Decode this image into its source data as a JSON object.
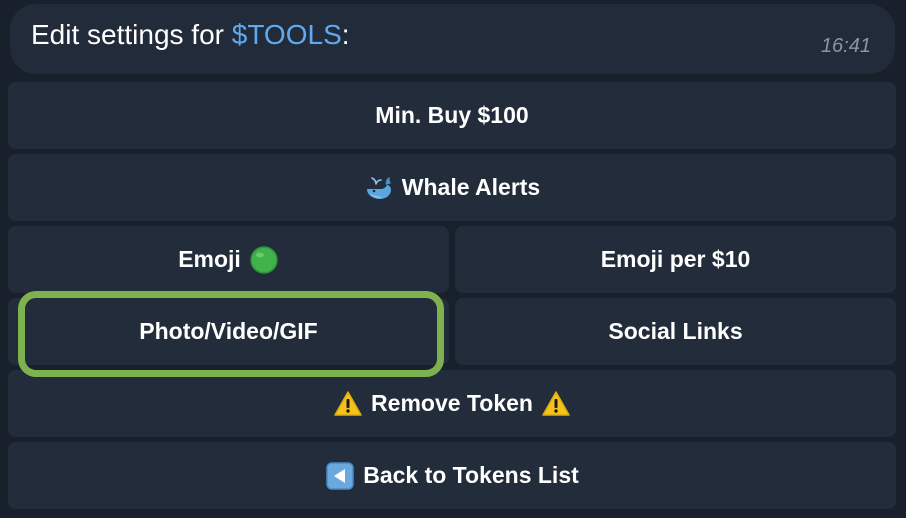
{
  "message": {
    "text_prefix": "Edit settings for ",
    "ticker": "$TOOLS",
    "text_suffix": ":",
    "time": "16:41"
  },
  "buttons": {
    "min_buy": "Min. Buy $100",
    "whale_alerts": "Whale Alerts",
    "emoji": "Emoji",
    "emoji_per": "Emoji per $10",
    "media": "Photo/Video/GIF",
    "social_links": "Social Links",
    "remove_token": "Remove Token",
    "back": "Back to Tokens List"
  },
  "icons": {
    "whale": "whale-icon",
    "emoji": "green-circle-icon",
    "warning": "warning-icon",
    "back": "back-arrow-icon"
  },
  "colors": {
    "ticker": "#5ea9f0",
    "highlight": "#7fb24f",
    "button_bg": "#222c3a",
    "background": "#18202b"
  }
}
